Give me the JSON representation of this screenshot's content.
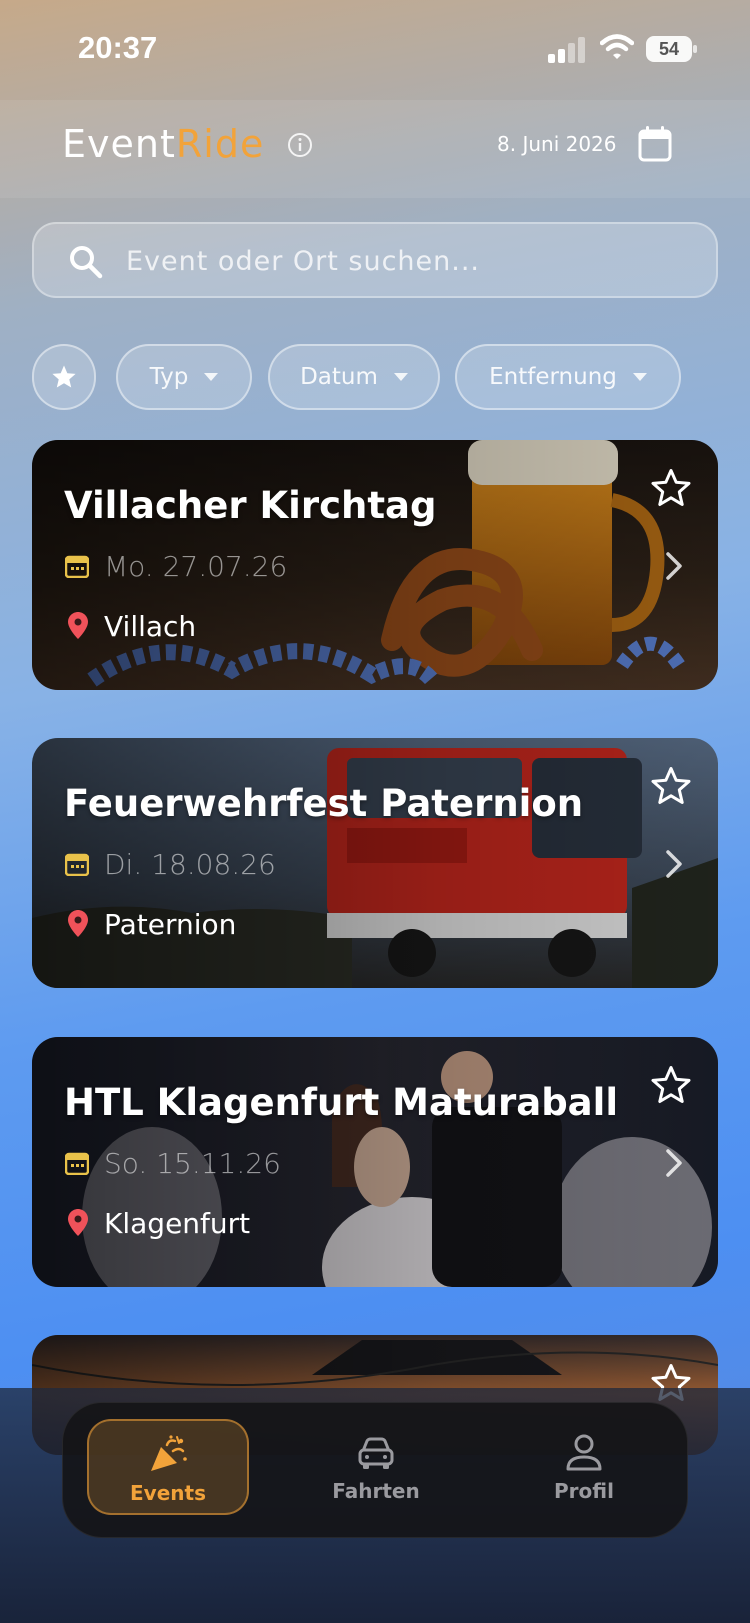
{
  "status_bar": {
    "time": "20:37",
    "battery": "54"
  },
  "header": {
    "logo_part1": "Event",
    "logo_part2": "Ride",
    "date": "8. Juni 2026",
    "brand_color": "#f2a33a"
  },
  "search": {
    "placeholder": "Event oder Ort suchen..."
  },
  "filters": {
    "type_label": "Typ",
    "date_label": "Datum",
    "distance_label": "Entfernung"
  },
  "events": [
    {
      "title": "Villacher Kirchtag",
      "date": "Mo. 27.07.26",
      "location": "Villach"
    },
    {
      "title": "Feuerwehrfest Paternion",
      "date": "Di. 18.08.26",
      "location": "Paternion"
    },
    {
      "title": "HTL Klagenfurt Maturaball",
      "date": "So. 15.11.26",
      "location": "Klagenfurt"
    }
  ],
  "tabbar": {
    "events_label": "Events",
    "rides_label": "Fahrten",
    "profile_label": "Profil"
  }
}
